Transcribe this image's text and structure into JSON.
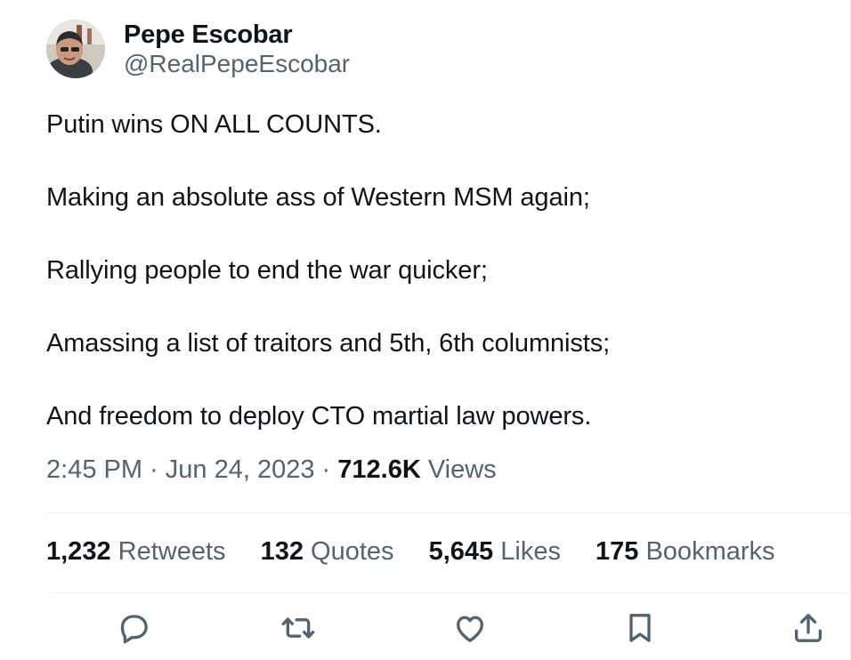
{
  "author": {
    "name": "Pepe Escobar",
    "handle": "@RealPepeEscobar"
  },
  "tweet": {
    "lines": [
      "Putin wins ON ALL COUNTS.",
      "Making an absolute ass of Western MSM again;",
      "Rallying people to end the war quicker;",
      "Amassing a list of traitors and 5th, 6th columnists;",
      "And freedom to deploy CTO martial law powers."
    ],
    "time": "2:45 PM",
    "date": "Jun 24, 2023",
    "separator": " · ",
    "views_count": "712.6K",
    "views_label": " Views"
  },
  "stats": {
    "retweets": {
      "count": "1,232",
      "label": " Retweets"
    },
    "quotes": {
      "count": "132",
      "label": " Quotes"
    },
    "likes": {
      "count": "5,645",
      "label": " Likes"
    },
    "bookmarks": {
      "count": "175",
      "label": " Bookmarks"
    }
  },
  "actions": {
    "reply_icon": "reply-icon",
    "retweet_icon": "retweet-icon",
    "like_icon": "heart-icon",
    "bookmark_icon": "bookmark-icon",
    "share_icon": "share-icon"
  },
  "colors": {
    "text": "#0f1419",
    "secondary": "#536471",
    "divider": "#eff3f4"
  }
}
